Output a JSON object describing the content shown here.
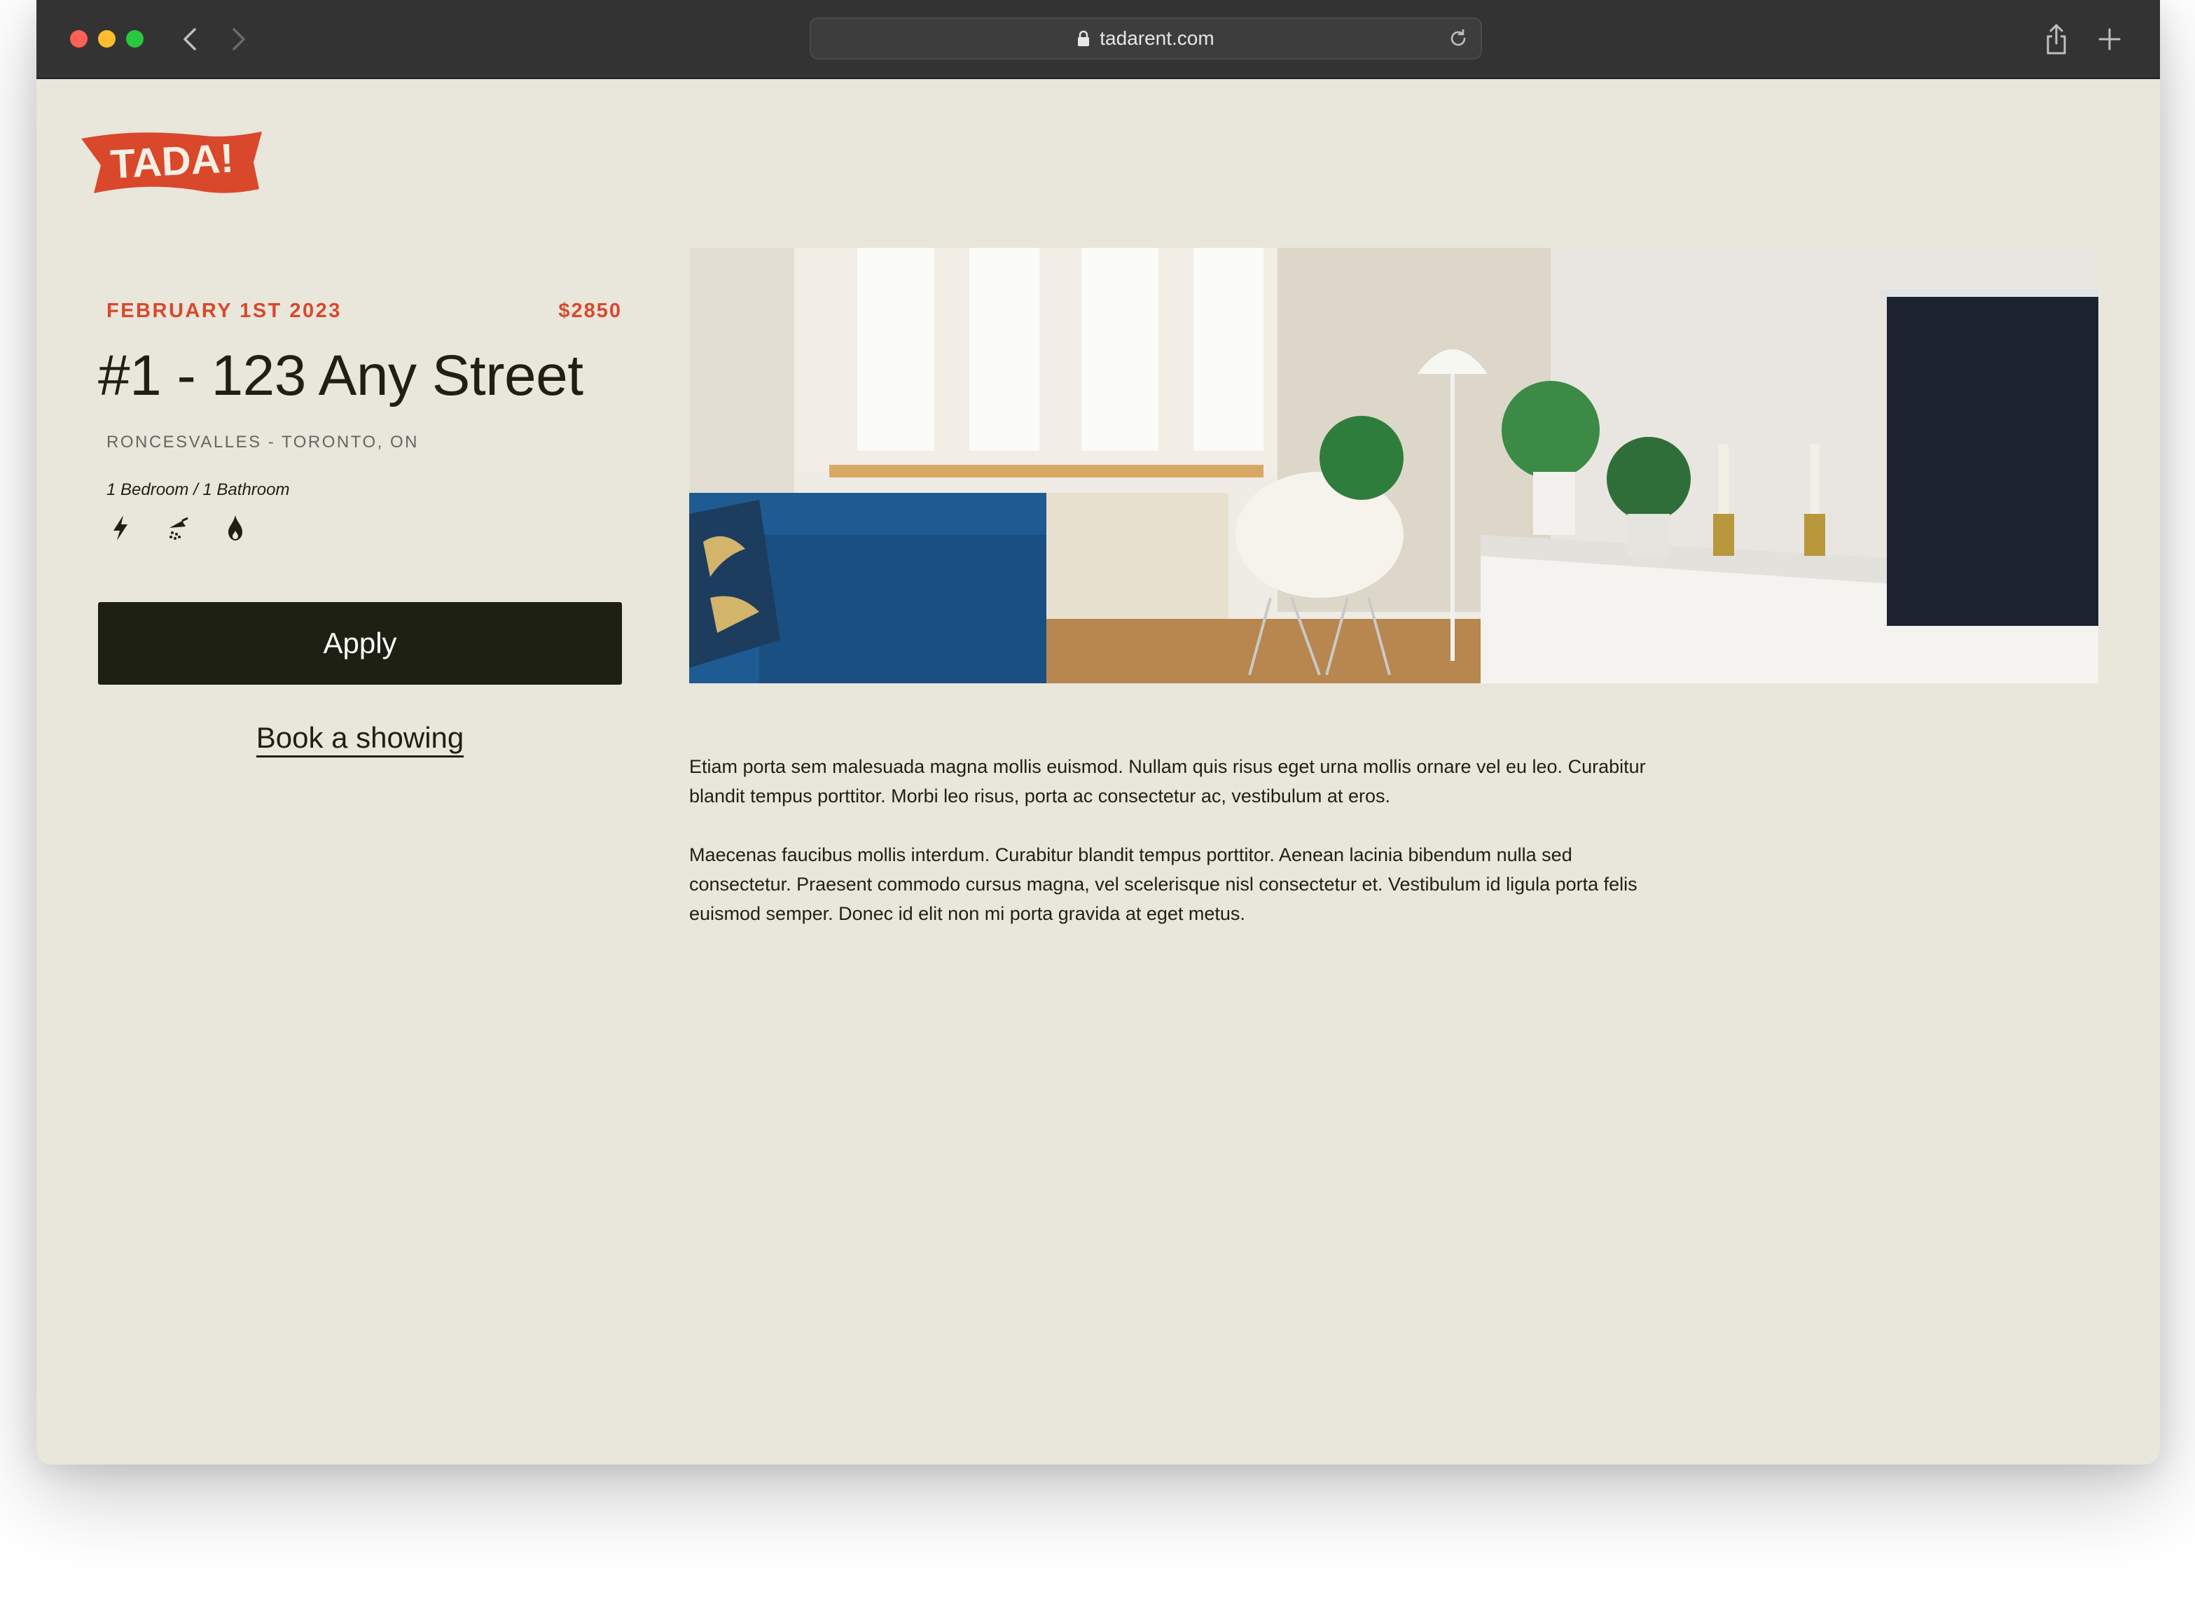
{
  "browser": {
    "url": "tadarent.com"
  },
  "brand": {
    "logo_text": "TADA!",
    "color": "#d9482b"
  },
  "listing": {
    "date": "FEBRUARY 1ST 2023",
    "price": "$2850",
    "title": "#1 - 123 Any Street",
    "location": "RONCESVALLES - TORONTO, ON",
    "rooms": "1 Bedroom / 1 Bathroom",
    "amenities": [
      "lightning-icon",
      "shower-icon",
      "flame-icon"
    ]
  },
  "actions": {
    "apply_label": "Apply",
    "showing_label": "Book a showing"
  },
  "description": {
    "paragraphs": [
      "Etiam porta sem malesuada magna mollis euismod. Nullam quis risus eget urna mollis ornare vel eu leo. Curabitur blandit tempus porttitor. Morbi leo risus, porta ac consectetur ac, vestibulum at eros.",
      "Maecenas faucibus mollis interdum.  Curabitur blandit tempus porttitor. Aenean lacinia bibendum nulla sed consectetur. Praesent commodo cursus magna, vel scelerisque nisl consectetur et. Vestibulum id ligula porta felis euismod semper. Donec id elit non mi porta gravida at eget metus."
    ]
  },
  "colors": {
    "page_background": "#e9e6dc",
    "accent": "#d9482b",
    "dark": "#1f2014"
  }
}
